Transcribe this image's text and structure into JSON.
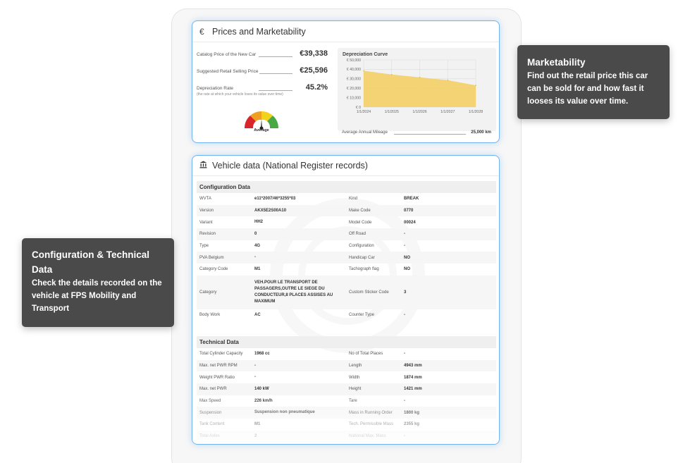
{
  "prices": {
    "title": "Prices and Marketability",
    "icon": "euro-icon",
    "rows": [
      {
        "label": "Catalog Price of the New Car",
        "value": "€39,338",
        "sub": ""
      },
      {
        "label": "Suggested Retail Selling Price",
        "value": "€25,596",
        "sub": ""
      },
      {
        "label": "Depreciation Rate",
        "value": "45.2%",
        "sub": "(the rate at which your vehicle loses its value over time)"
      }
    ],
    "gauge_label": "Average",
    "mileage_label": "Average Annual Mileage",
    "mileage_value": "25,000 km"
  },
  "chart_data": {
    "type": "area",
    "title": "Depreciation Curve",
    "x": [
      "1/1/2024",
      "1/1/2025",
      "1/1/2026",
      "1/1/2027",
      "1/1/2028"
    ],
    "series": [
      {
        "values": [
          38500,
          34500,
          31500,
          28500,
          23000
        ]
      }
    ],
    "y_ticks": [
      "€ 50,000",
      "€ 40,000",
      "€ 30,000",
      "€ 20,000",
      "€ 10,000",
      "€ 0"
    ],
    "ylim": [
      0,
      50000
    ],
    "color": "#f2d16b",
    "grid": true
  },
  "vehicle": {
    "title": "Vehicle data (National Register records)",
    "icon": "bank-icon",
    "config_title": "Configuration Data",
    "config_rows": [
      [
        "WVTA",
        "e11*2007/46*3255*03",
        "Kind",
        "BREAK"
      ],
      [
        "Version",
        "AKX5E2S00A10",
        "Make Code",
        "0770"
      ],
      [
        "Variant",
        "HH2",
        "Model Code",
        "00024"
      ],
      [
        "Revision",
        "0",
        "Off Road",
        "-"
      ],
      [
        "Type",
        "4G",
        "Configuration",
        "-"
      ],
      [
        "PVA Belgium",
        "-",
        "Handicap Car",
        "NO"
      ],
      [
        "Category Code",
        "M1",
        "Tachograph flag",
        "NO"
      ],
      [
        "Category",
        "VEH.POUR LE TRANSPORT DE PASSAGERS,OUTRE LE SIEGE DU CONDUCTEUR,8 PLACES ASSISES AU MAXIMUM",
        "Custom Sticker Code",
        "3"
      ],
      [
        "Body Work",
        "AC",
        "Counter Type",
        "-"
      ]
    ],
    "tech_title": "Technical Data",
    "tech_rows": [
      [
        "Total Cylinder Capacity",
        "1968 cc",
        "No of Total Places",
        "-"
      ],
      [
        "Max. net PWR RPM",
        "-",
        "Length",
        "4943 mm"
      ],
      [
        "Weight PWR Ratio",
        "-",
        "Width",
        "1874 mm"
      ],
      [
        "Max. net PWR",
        "140 kW",
        "Height",
        "1421 mm"
      ],
      [
        "Max Speed",
        "226 km/h",
        "Tare",
        "-"
      ],
      [
        "Suspension",
        "Suspension non pneumatique",
        "Mass in Running Order",
        "1800 kg"
      ],
      [
        "Tank Content",
        "M1",
        "Tech. Permissible Mass",
        "2355 kg"
      ],
      [
        "Total Axles",
        "2",
        "National Max. Mass",
        "-"
      ]
    ]
  },
  "tips": {
    "market_title": "Marketability",
    "market_text": "Find out the retail price this car can be sold for and how fast it looses its value over time.",
    "config_title": "Configuration & Technical Data",
    "config_text": "Check the details recorded on the vehicle at FPS Mobility and Transport"
  }
}
